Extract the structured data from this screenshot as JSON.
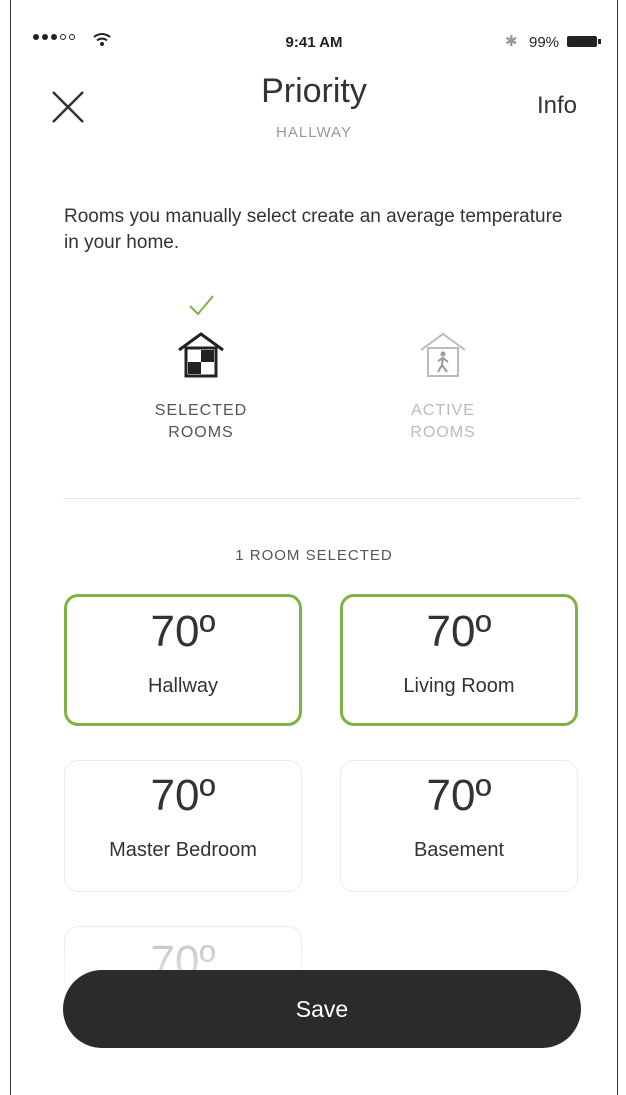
{
  "status_bar": {
    "time": "9:41 AM",
    "battery": "99%"
  },
  "header": {
    "title": "Priority",
    "subtitle": "HALLWAY",
    "info_label": "Info"
  },
  "description": "Rooms you manually select create an average temperature in your home.",
  "modes": [
    {
      "label_line1": "SELECTED",
      "label_line2": "ROOMS",
      "selected": true,
      "icon": "house-selected-rooms-icon"
    },
    {
      "label_line1": "ACTIVE",
      "label_line2": "ROOMS",
      "selected": false,
      "icon": "house-active-rooms-icon"
    }
  ],
  "room_count": "1 ROOM SELECTED",
  "rooms": [
    {
      "temp": "70º",
      "name": "Hallway",
      "selected": true
    },
    {
      "temp": "70º",
      "name": "Living Room",
      "selected": true
    },
    {
      "temp": "70º",
      "name": "Master Bedroom",
      "selected": false
    },
    {
      "temp": "70º",
      "name": "Basement",
      "selected": false
    },
    {
      "temp": "70º",
      "name": "",
      "selected": false
    }
  ],
  "save_label": "Save",
  "colors": {
    "accent_green": "#7cb342",
    "button_dark": "#2b2b2b"
  }
}
